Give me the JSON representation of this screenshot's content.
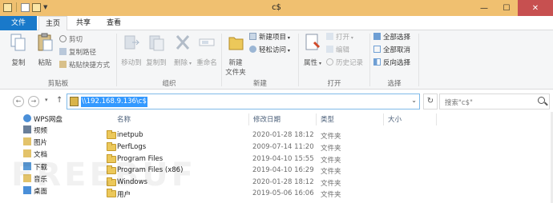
{
  "window": {
    "title": "c$",
    "minimize_icon": "minimize-icon",
    "maximize_icon": "maximize-icon",
    "close_icon": "close-icon"
  },
  "tabs": [
    {
      "label": "文件"
    },
    {
      "label": "主页"
    },
    {
      "label": "共享"
    },
    {
      "label": "查看"
    }
  ],
  "ribbon": {
    "clipboard": {
      "label": "剪贴板",
      "copy": "复制",
      "paste": "粘贴",
      "cut": "剪切",
      "copy_path": "复制路径",
      "paste_shortcut": "粘贴快捷方式"
    },
    "organize": {
      "label": "组织",
      "move_to": "移动到",
      "copy_to": "复制到",
      "delete": "删除",
      "rename": "重命名"
    },
    "new": {
      "label": "新建",
      "new_folder": "新建\n文件夹",
      "new_folder_line1": "新建",
      "new_folder_line2": "文件夹",
      "new_item": "新建项目",
      "easy_access": "轻松访问"
    },
    "open": {
      "label": "打开",
      "properties": "属性",
      "open": "打开",
      "edit": "编辑",
      "history": "历史记录"
    },
    "select": {
      "label": "选择",
      "select_all": "全部选择",
      "select_none": "全部取消",
      "invert": "反向选择"
    }
  },
  "address": {
    "path": "\\\\192.168.9.136\\c$",
    "search_placeholder": "搜索\"c$\""
  },
  "nav_pane": [
    {
      "label": "WPS网盘",
      "icon": "cloud-icon"
    },
    {
      "label": "视频",
      "icon": "video-folder-icon"
    },
    {
      "label": "图片",
      "icon": "pictures-folder-icon"
    },
    {
      "label": "文档",
      "icon": "documents-folder-icon"
    },
    {
      "label": "下载",
      "icon": "downloads-folder-icon"
    },
    {
      "label": "音乐",
      "icon": "music-folder-icon"
    },
    {
      "label": "桌面",
      "icon": "desktop-folder-icon"
    }
  ],
  "columns": {
    "name": "名称",
    "date": "修改日期",
    "type": "类型",
    "size": "大小"
  },
  "files": [
    {
      "name": "inetpub",
      "date": "2020-01-28 18:12",
      "type": "文件夹"
    },
    {
      "name": "PerfLogs",
      "date": "2009-07-14 11:20",
      "type": "文件夹"
    },
    {
      "name": "Program Files",
      "date": "2019-04-10 15:55",
      "type": "文件夹"
    },
    {
      "name": "Program Files (x86)",
      "date": "2019-04-10 16:29",
      "type": "文件夹"
    },
    {
      "name": "Windows",
      "date": "2020-01-28 18:12",
      "type": "文件夹"
    },
    {
      "name": "用户",
      "date": "2019-05-06 16:06",
      "type": "文件夹"
    }
  ],
  "watermark": "FREEBUF",
  "colors": {
    "titlebar": "#f0c070",
    "file_tab": "#1979ca",
    "close_button": "#c75050",
    "selection": "#3399ff"
  }
}
